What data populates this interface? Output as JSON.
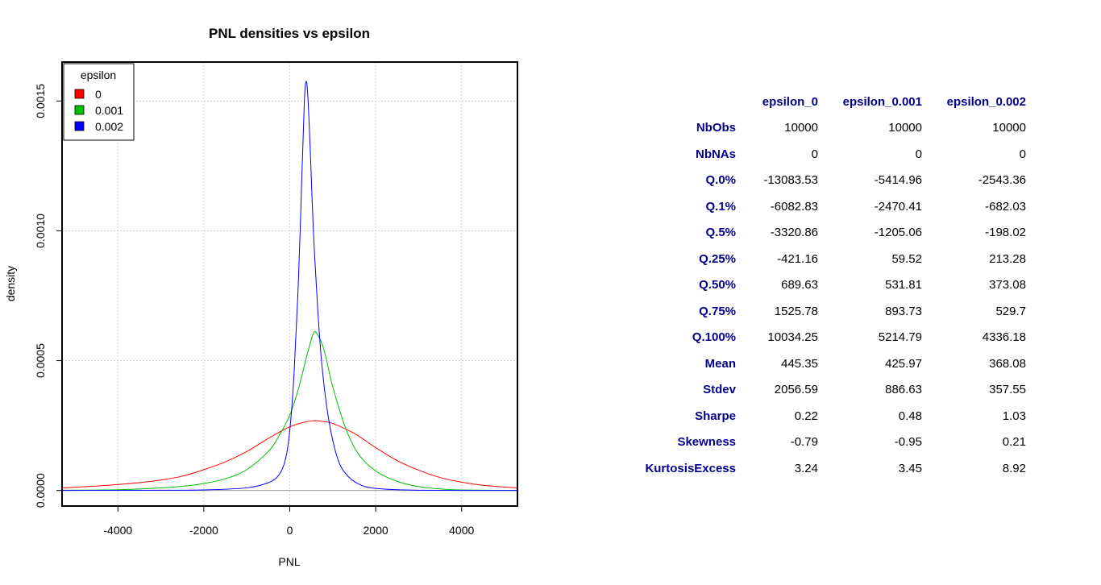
{
  "chart_data": {
    "type": "line",
    "title": "PNL densities vs epsilon",
    "xlabel": "PNL",
    "ylabel": "density",
    "xlim": [
      -5300,
      5300
    ],
    "ylim": [
      -6e-05,
      0.00165
    ],
    "xticks": [
      -4000,
      -2000,
      0,
      2000,
      4000
    ],
    "xtick_labels": [
      "-4000",
      "-2000",
      "0",
      "2000",
      "4000"
    ],
    "yticks": [
      0,
      0.0005,
      0.001,
      0.0015
    ],
    "ytick_labels": [
      "0.0000",
      "0.0005",
      "0.0010",
      "0.0015"
    ],
    "grid": true,
    "legend": {
      "title": "epsilon",
      "position": "top-left"
    },
    "series": [
      {
        "name": "0",
        "color": "#ff0000",
        "x": [
          -5300,
          -4500,
          -4000,
          -3500,
          -3000,
          -2500,
          -2000,
          -1500,
          -1000,
          -500,
          0,
          500,
          800,
          1000,
          1500,
          2000,
          2500,
          3000,
          3500,
          4000,
          4500,
          5300
        ],
        "y": [
          1e-05,
          1.7e-05,
          2.3e-05,
          3e-05,
          4e-05,
          5.5e-05,
          8e-05,
          0.00011,
          0.00015,
          0.0002,
          0.000245,
          0.000268,
          0.000265,
          0.000258,
          0.00022,
          0.000165,
          0.000115,
          7.8e-05,
          5e-05,
          3.2e-05,
          2e-05,
          1e-05
        ]
      },
      {
        "name": "0.001",
        "color": "#00bf00",
        "x": [
          -5300,
          -4000,
          -3000,
          -2500,
          -2000,
          -1500,
          -1000,
          -500,
          -250,
          0,
          200,
          400,
          550,
          650,
          800,
          1000,
          1300,
          1600,
          2000,
          2500,
          3000,
          3500,
          4000,
          5300
        ],
        "y": [
          1e-06,
          3e-06,
          1e-05,
          1.6e-05,
          2.7e-05,
          4.5e-05,
          8e-05,
          0.00015,
          0.00021,
          0.00029,
          0.00039,
          0.00052,
          0.000605,
          0.0006,
          0.00054,
          0.0004,
          0.00024,
          0.00014,
          7.5e-05,
          3.5e-05,
          1.5e-05,
          6e-06,
          2e-06,
          0.0
        ]
      },
      {
        "name": "0.002",
        "color": "#0000ff",
        "x": [
          -5300,
          -3000,
          -2000,
          -1000,
          -500,
          -250,
          -100,
          0,
          100,
          200,
          280,
          340,
          380,
          420,
          480,
          550,
          650,
          750,
          900,
          1100,
          1300,
          1600,
          2000,
          3000,
          5300
        ],
        "y": [
          0.0,
          1e-06,
          2e-06,
          1e-05,
          3e-05,
          6e-05,
          0.00012,
          0.00023,
          0.00045,
          0.0008,
          0.0012,
          0.0015,
          0.001575,
          0.00152,
          0.0013,
          0.001,
          0.0007,
          0.00048,
          0.00028,
          0.00013,
          6.5e-05,
          2.5e-05,
          8e-06,
          1e-06,
          0.0
        ]
      }
    ]
  },
  "stats_table": {
    "columns": [
      "epsilon_0",
      "epsilon_0.001",
      "epsilon_0.002"
    ],
    "rows": [
      {
        "label": "NbObs",
        "values": [
          "10000",
          "10000",
          "10000"
        ]
      },
      {
        "label": "NbNAs",
        "values": [
          "0",
          "0",
          "0"
        ]
      },
      {
        "label": "Q.0%",
        "values": [
          "-13083.53",
          "-5414.96",
          "-2543.36"
        ]
      },
      {
        "label": "Q.1%",
        "values": [
          "-6082.83",
          "-2470.41",
          "-682.03"
        ]
      },
      {
        "label": "Q.5%",
        "values": [
          "-3320.86",
          "-1205.06",
          "-198.02"
        ]
      },
      {
        "label": "Q.25%",
        "values": [
          "-421.16",
          "59.52",
          "213.28"
        ]
      },
      {
        "label": "Q.50%",
        "values": [
          "689.63",
          "531.81",
          "373.08"
        ]
      },
      {
        "label": "Q.75%",
        "values": [
          "1525.78",
          "893.73",
          "529.7"
        ]
      },
      {
        "label": "Q.100%",
        "values": [
          "10034.25",
          "5214.79",
          "4336.18"
        ]
      },
      {
        "label": "Mean",
        "values": [
          "445.35",
          "425.97",
          "368.08"
        ]
      },
      {
        "label": "Stdev",
        "values": [
          "2056.59",
          "886.63",
          "357.55"
        ]
      },
      {
        "label": "Sharpe",
        "values": [
          "0.22",
          "0.48",
          "1.03"
        ]
      },
      {
        "label": "Skewness",
        "values": [
          "-0.79",
          "-0.95",
          "0.21"
        ]
      },
      {
        "label": "KurtosisExcess",
        "values": [
          "3.24",
          "3.45",
          "8.92"
        ]
      }
    ]
  }
}
